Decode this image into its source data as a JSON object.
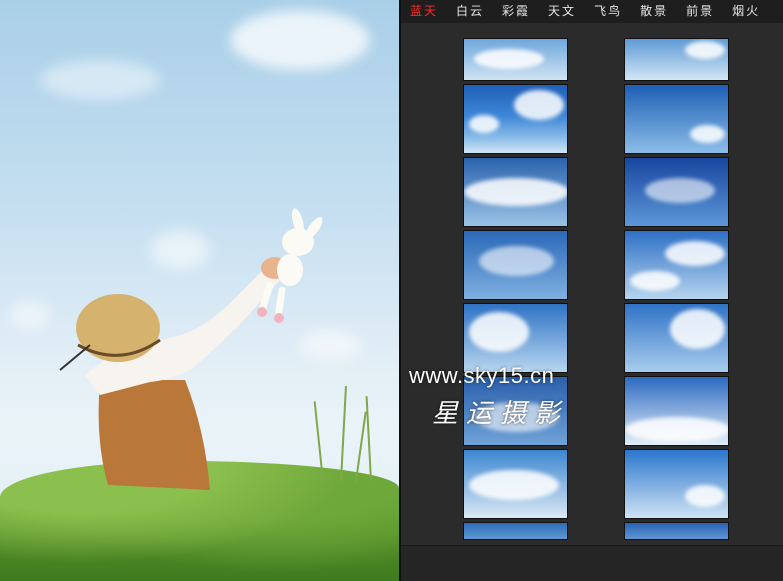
{
  "tabs": [
    {
      "label": "蓝天",
      "active": true
    },
    {
      "label": "白云",
      "active": false
    },
    {
      "label": "彩霞",
      "active": false
    },
    {
      "label": "天文",
      "active": false
    },
    {
      "label": "飞鸟",
      "active": false
    },
    {
      "label": "散景",
      "active": false
    },
    {
      "label": "前景",
      "active": false
    },
    {
      "label": "烟火",
      "active": false
    }
  ],
  "watermark": {
    "url": "www.sky15.cn",
    "brand": "星运摄影"
  },
  "colors": {
    "active_tab": "#ff2a2a",
    "tab_text": "#e6e6e6",
    "panel_bg": "#2b2b2b",
    "tabbar_bg": "#1e1e1e"
  },
  "thumbnails_count": 16
}
